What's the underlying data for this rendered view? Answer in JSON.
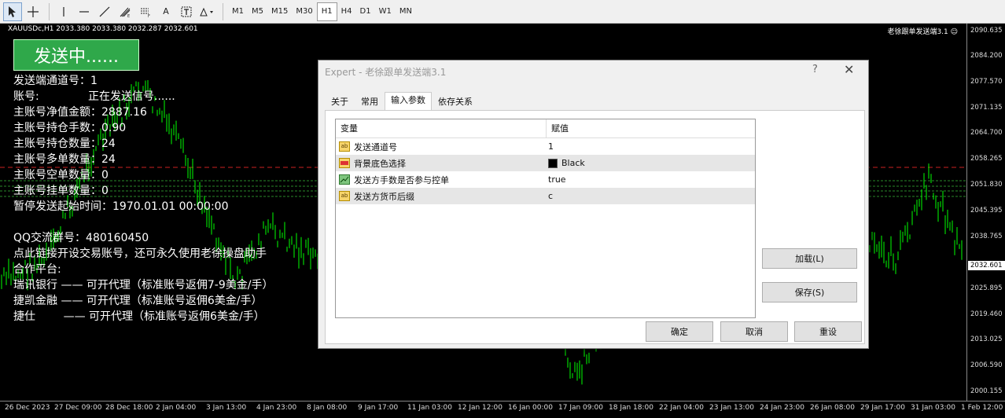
{
  "toolbar": {
    "tools": [
      "cursor-icon",
      "crosshair-icon",
      "vertical-line-icon",
      "horizontal-line-icon",
      "trendline-icon",
      "fibonacci-icon",
      "channel-icon",
      "text-icon",
      "text-label-icon",
      "shapes-icon"
    ],
    "text_tool_label": "A",
    "timeframes": [
      "M1",
      "M5",
      "M15",
      "M30",
      "H1",
      "H4",
      "D1",
      "W1",
      "MN"
    ],
    "active_timeframe": "H1"
  },
  "chart": {
    "symbol": "XAUUSDc,H1  2033.380 2033.380 2032.287 2032.601",
    "ea_name": "老徐跟单发送端3.1 ☺",
    "bg_color": "#000000",
    "candle_color": "#00ff00",
    "price_ticks": [
      "2090.635",
      "2084.200",
      "2077.570",
      "2071.135",
      "2064.700",
      "2058.265",
      "2051.830",
      "2045.395",
      "2038.765",
      "2032.601",
      "2025.895",
      "2019.460",
      "2013.025",
      "2006.590",
      "2000.155"
    ],
    "current_price": "2032.601",
    "time_ticks": [
      "26 Dec 2023",
      "27 Dec 09:00",
      "28 Dec 18:00",
      "2 Jan 04:00",
      "3 Jan 13:00",
      "4 Jan 23:00",
      "8 Jan 08:00",
      "9 Jan 17:00",
      "11 Jan 03:00",
      "12 Jan 12:00",
      "16 Jan 00:00",
      "17 Jan 09:00",
      "18 Jan 18:00",
      "22 Jan 04:00",
      "23 Jan 13:00",
      "24 Jan 23:00",
      "26 Jan 08:00",
      "29 Jan 17:00",
      "31 Jan 03:00",
      "1 Feb 12:00"
    ]
  },
  "overlay": {
    "send_button": "发送中......",
    "lines": [
      "发送端通道号：1",
      "账号:              正在发送信号......",
      "主账号净值金额：2887.16",
      "主账号持仓手数：0.90",
      "主账号持仓数量：24",
      "主账号多单数量：24",
      "主账号空单数量：0",
      "主账号挂单数量：0",
      "暂停发送起始时间：1970.01.01 00:00:00",
      "QQ交流群号：480160450",
      "点此链接开设交易账号，还可永久使用老徐操盘助手",
      "合作平台:",
      "瑞讯银行 —— 可开代理（标准账号返佣7-9美金/手）",
      "捷凯金融 —— 可开代理（标准账号返佣6美金/手）",
      "捷仕        —— 可开代理（标准账号返佣6美金/手）"
    ]
  },
  "dialog": {
    "title": "Expert - 老徐跟单发送端3.1",
    "help": "?",
    "close": "✕",
    "tabs": [
      "关于",
      "常用",
      "输入参数",
      "依存关系"
    ],
    "active_tab": "输入参数",
    "columns": [
      "变量",
      "赋值"
    ],
    "params": [
      {
        "name": "发送通道号",
        "value": "1",
        "icon": "ab"
      },
      {
        "name": "背景底色选择",
        "value": "Black",
        "icon": "color"
      },
      {
        "name": "发送方手数是否参与控单",
        "value": "true",
        "icon": "bool"
      },
      {
        "name": "发送方货币后缀",
        "value": "c",
        "icon": "ab"
      }
    ],
    "buttons": {
      "load": "加载(L)",
      "save": "保存(S)",
      "ok": "确定",
      "cancel": "取消",
      "reset": "重设"
    }
  }
}
